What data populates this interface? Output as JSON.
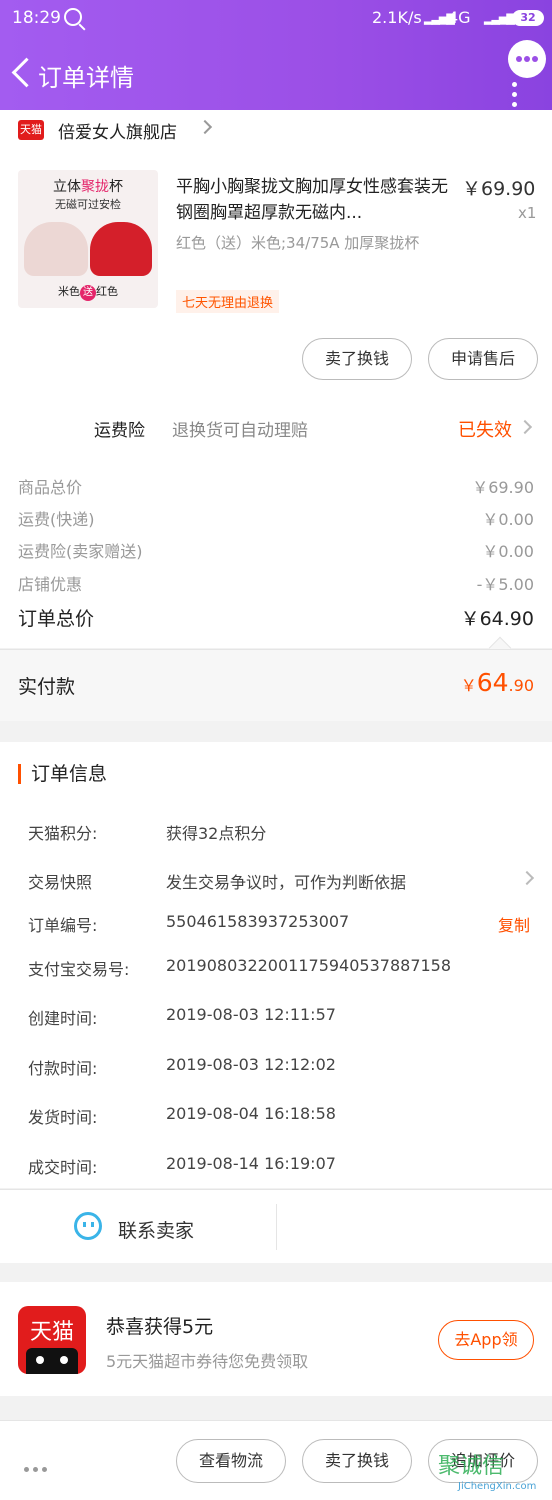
{
  "status_bar": {
    "time": "18:29",
    "net_speed": "2.1K/s",
    "network": "4G",
    "battery": "32"
  },
  "header": {
    "title": "订单详情"
  },
  "shop": {
    "name": "倍爱女人旗舰店",
    "logo_text": "天猫"
  },
  "item": {
    "image_text_top": "立体",
    "image_text_highlight": "聚拢",
    "image_text_top_end": "杯",
    "image_text_sub": "无磁可过安检",
    "image_caption_left": "米色",
    "image_caption_mid": "送",
    "image_caption_right": "红色",
    "title": "平胸小胸聚拢文胸加厚女性感套装无钢圈胸罩超厚款无磁内...",
    "price": "￥69.90",
    "qty": "x1",
    "sku": "红色（送）米色;34/75A 加厚聚拢杯",
    "tag": "七天无理由退换",
    "btn_sell": "卖了换钱",
    "btn_aftersale": "申请售后"
  },
  "insurance": {
    "label": "运费险",
    "desc": "退换货可自动理赔",
    "state": "已失效"
  },
  "costs": {
    "rows": [
      {
        "label": "商品总价",
        "value": "￥69.90"
      },
      {
        "label": "运费(快递)",
        "value": "￥0.00"
      },
      {
        "label": "运费险(卖家赠送)",
        "value": "￥0.00"
      },
      {
        "label": "店铺优惠",
        "value": "-￥5.00"
      }
    ],
    "total_label": "订单总价",
    "total_value": "￥64.90"
  },
  "paid": {
    "label": "实付款",
    "currency": "￥",
    "int": "64",
    "dec": ".90"
  },
  "order_info": {
    "heading": "订单信息",
    "rows": [
      {
        "label": "天猫积分:",
        "value": "获得32点积分"
      },
      {
        "label": "交易快照",
        "value": "发生交易争议时，可作为判断依据"
      },
      {
        "label": "订单编号:",
        "value": "550461583937253007",
        "action": "复制"
      },
      {
        "label": "支付宝交易号:",
        "value": "2019080322001175940537887158"
      },
      {
        "label": "创建时间:",
        "value": "2019-08-03 12:11:57"
      },
      {
        "label": "付款时间:",
        "value": "2019-08-03 12:12:02"
      },
      {
        "label": "发货时间:",
        "value": "2019-08-04 16:18:58"
      },
      {
        "label": "成交时间:",
        "value": "2019-08-14 16:19:07"
      }
    ]
  },
  "contact": {
    "label": "联系卖家"
  },
  "promo": {
    "logo_text": "天猫",
    "title": "恭喜获得5元",
    "sub": "5元天猫超市券待您免费领取",
    "btn": "去App领"
  },
  "bottom": {
    "btn_logistics": "查看物流",
    "btn_sell": "卖了换钱",
    "btn_review": "追加评价"
  },
  "watermark": {
    "text": "聚诚信",
    "url": "JiChengXin.com"
  }
}
